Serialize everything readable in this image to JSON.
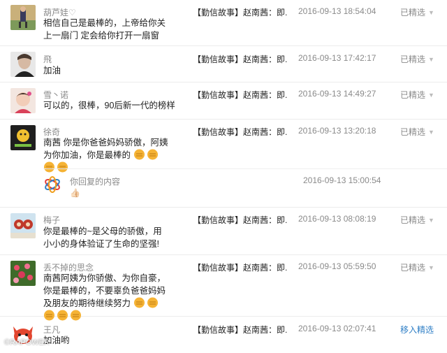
{
  "comments": [
    {
      "name": "葫芦娃",
      "name_badge": "♡",
      "text": "相信自己是最棒的，上帝给你关上一扇门 定会给你打开一扇窗",
      "emoji_count": 0,
      "article": "【勤信故事】赵南茜：即...",
      "time": "2016-09-13 18:54:04",
      "status": "已精选",
      "avatar_icon": "sports-player-avatar"
    },
    {
      "name": "飛",
      "text": "加油",
      "emoji_count": 0,
      "article": "【勤信故事】赵南茜：即...",
      "time": "2016-09-13 17:42:17",
      "status": "已精选",
      "avatar_icon": "man-portrait-avatar"
    },
    {
      "name": "雪丶诺",
      "text": "可以的，很棒，90后新一代的榜样",
      "emoji_count": 0,
      "article": "【勤信故事】赵南茜：即...",
      "time": "2016-09-13 14:49:27",
      "status": "已精选",
      "avatar_icon": "child-avatar"
    },
    {
      "name": "徐奇",
      "text": "南茜 你是你爸爸妈妈骄傲，阿姨为你加油，你是最棒的",
      "emoji_count": 4,
      "article": "【勤信故事】赵南茜：即...",
      "time": "2016-09-13 13:20:18",
      "status": "已精选",
      "avatar_icon": "cartoon-avatar"
    },
    {
      "name": "梅子",
      "text": "你是最棒的~是父母的骄傲，用小小的身体验证了生命的坚强!",
      "emoji_count": 0,
      "article": "【勤信故事】赵南茜：即...",
      "time": "2016-09-13 08:08:19",
      "status": "已精选",
      "avatar_icon": "toy-figures-avatar"
    },
    {
      "name": "丢不掉的思念",
      "text": "南茜阿姨为你骄傲、为你自豪，你是最棒的，不要辜负爸爸妈妈及朋友的期待继续努力",
      "emoji_count": 5,
      "article": "【勤信故事】赵南茜：即...",
      "time": "2016-09-13 05:59:50",
      "status": "已精选",
      "avatar_icon": "flowers-avatar"
    },
    {
      "name": "王凡",
      "text": "加油哟",
      "emoji_count": 0,
      "article": "【勤信故事】赵南茜：即...",
      "time": "2016-09-13 02:07:41",
      "status": "移入精选",
      "avatar_icon": "fox-cartoon-avatar"
    }
  ],
  "reply": {
    "label": "你回复的内容",
    "content": "👍🏻",
    "time": "2016-09-13 15:00:54",
    "logo_icon": "official-account-logo-icon"
  },
  "emoji_name": "fist-emoji",
  "watermark": "©RAPOWER",
  "colors": {
    "link": "#2f7fc6",
    "muted": "#8a8a8a",
    "divider": "#ececec"
  }
}
